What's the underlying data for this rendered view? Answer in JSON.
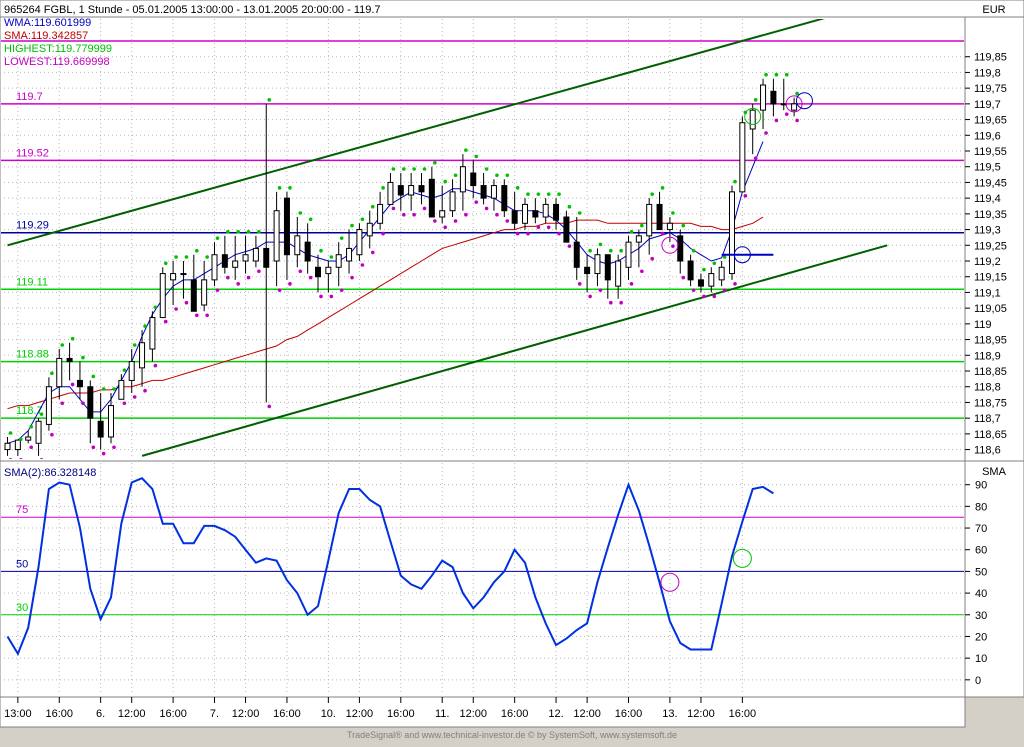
{
  "header": {
    "title": "965264  FGBL, 1 Stunde - 05.01.2005 13:00:00 - 13.01.2005 20:00:00 - 119.7",
    "legend": [
      {
        "text": "WMA:119.601999",
        "color": "#0000c0"
      },
      {
        "text": "SMA:119.342857",
        "color": "#c00000"
      },
      {
        "text": "HIGHEST:119.779999",
        "color": "#00c000"
      },
      {
        "text": "LOWEST:119.669998",
        "color": "#c000c0"
      }
    ],
    "currency": "EUR"
  },
  "lower_panel": {
    "legend": "SMA(2):86.328148",
    "indicator_label": "SMA"
  },
  "footer": {
    "credit": "TradeSignal® and www.technical-investor.de © by SystemSoft, www.systemsoft.de"
  },
  "colors": {
    "candle_up": "#ffffff",
    "candle_down": "#000000",
    "wma": "#0000c0",
    "sma": "#c00000",
    "highest": "#00c000",
    "lowest": "#c000c0",
    "channel": "#006000",
    "level_magenta": "#d000d0",
    "level_blue": "#0000a0",
    "level_green": "#00d000",
    "osc": "#0030e0"
  },
  "chart_data": [
    {
      "type": "candlestick",
      "title": "965264  FGBL, 1 Stunde",
      "ylim": [
        118.57,
        119.97
      ],
      "y_ticks": [
        118.6,
        118.65,
        118.7,
        118.75,
        118.8,
        118.85,
        118.9,
        118.95,
        119,
        119.05,
        119.1,
        119.15,
        119.2,
        119.25,
        119.3,
        119.35,
        119.4,
        119.45,
        119.5,
        119.55,
        119.6,
        119.65,
        119.7,
        119.75,
        119.8,
        119.85
      ],
      "x_tick_labels": [
        "13:00",
        "16:00",
        "6.",
        "12:00",
        "16:00",
        "7.",
        "12:00",
        "16:00",
        "10.",
        "12:00",
        "16:00",
        "11.",
        "12:00",
        "16:00",
        "12.",
        "12:00",
        "16:00",
        "13.",
        "12:00",
        "16:00"
      ],
      "x_tick_bars": [
        1,
        5,
        9,
        12,
        16,
        20,
        23,
        27,
        31,
        34,
        38,
        42,
        45,
        49,
        53,
        56,
        60,
        64,
        67,
        71
      ],
      "candles": [
        [
          118.64,
          118.58,
          118.6,
          118.62
        ],
        [
          118.62,
          118.58,
          118.6,
          118.63
        ],
        [
          118.66,
          118.62,
          118.63,
          118.64
        ],
        [
          118.7,
          118.58,
          118.62,
          118.69
        ],
        [
          118.83,
          118.66,
          118.68,
          118.8
        ],
        [
          118.92,
          118.76,
          118.8,
          118.89
        ],
        [
          118.94,
          118.82,
          118.89,
          118.88
        ],
        [
          118.88,
          118.76,
          118.82,
          118.8
        ],
        [
          118.82,
          118.62,
          118.8,
          118.7
        ],
        [
          118.78,
          118.6,
          118.69,
          118.64
        ],
        [
          118.78,
          118.62,
          118.64,
          118.74
        ],
        [
          118.84,
          118.76,
          118.76,
          118.82
        ],
        [
          118.92,
          118.78,
          118.82,
          118.88
        ],
        [
          118.98,
          118.8,
          118.86,
          118.94
        ],
        [
          119.04,
          118.88,
          118.92,
          119.02
        ],
        [
          119.18,
          119.02,
          119.02,
          119.16
        ],
        [
          119.2,
          119.06,
          119.14,
          119.16
        ],
        [
          119.2,
          119.08,
          119.16,
          119.16
        ],
        [
          119.22,
          119.04,
          119.14,
          119.04
        ],
        [
          119.2,
          119.04,
          119.06,
          119.14
        ],
        [
          119.26,
          119.12,
          119.14,
          119.22
        ],
        [
          119.28,
          119.16,
          119.22,
          119.18
        ],
        [
          119.28,
          119.14,
          119.18,
          119.2
        ],
        [
          119.28,
          119.16,
          119.2,
          119.22
        ],
        [
          119.28,
          119.18,
          119.2,
          119.24
        ],
        [
          119.7,
          118.75,
          119.24,
          119.18
        ],
        [
          119.42,
          119.12,
          119.2,
          119.36
        ],
        [
          119.42,
          119.14,
          119.4,
          119.22
        ],
        [
          119.34,
          119.18,
          119.22,
          119.28
        ],
        [
          119.32,
          119.16,
          119.26,
          119.2
        ],
        [
          119.22,
          119.1,
          119.18,
          119.15
        ],
        [
          119.2,
          119.1,
          119.16,
          119.18
        ],
        [
          119.26,
          119.12,
          119.18,
          119.22
        ],
        [
          119.3,
          119.16,
          119.2,
          119.24
        ],
        [
          119.32,
          119.2,
          119.22,
          119.3
        ],
        [
          119.36,
          119.24,
          119.28,
          119.32
        ],
        [
          119.42,
          119.3,
          119.32,
          119.38
        ],
        [
          119.48,
          119.38,
          119.38,
          119.45
        ],
        [
          119.48,
          119.36,
          119.44,
          119.41
        ],
        [
          119.48,
          119.36,
          119.41,
          119.44
        ],
        [
          119.48,
          119.38,
          119.44,
          119.42
        ],
        [
          119.5,
          119.34,
          119.46,
          119.34
        ],
        [
          119.44,
          119.32,
          119.34,
          119.36
        ],
        [
          119.46,
          119.34,
          119.36,
          119.42
        ],
        [
          119.54,
          119.36,
          119.42,
          119.5
        ],
        [
          119.52,
          119.4,
          119.48,
          119.44
        ],
        [
          119.48,
          119.38,
          119.44,
          119.4
        ],
        [
          119.46,
          119.36,
          119.4,
          119.44
        ],
        [
          119.46,
          119.34,
          119.44,
          119.36
        ],
        [
          119.42,
          119.3,
          119.36,
          119.32
        ],
        [
          119.4,
          119.3,
          119.32,
          119.38
        ],
        [
          119.4,
          119.32,
          119.36,
          119.34
        ],
        [
          119.4,
          119.32,
          119.34,
          119.38
        ],
        [
          119.4,
          119.3,
          119.38,
          119.33
        ],
        [
          119.36,
          119.26,
          119.34,
          119.26
        ],
        [
          119.34,
          119.14,
          119.26,
          119.18
        ],
        [
          119.22,
          119.1,
          119.18,
          119.16
        ],
        [
          119.24,
          119.12,
          119.16,
          119.22
        ],
        [
          119.22,
          119.08,
          119.22,
          119.14
        ],
        [
          119.22,
          119.08,
          119.12,
          119.2
        ],
        [
          119.28,
          119.14,
          119.18,
          119.26
        ],
        [
          119.3,
          119.18,
          119.26,
          119.28
        ],
        [
          119.4,
          119.22,
          119.28,
          119.38
        ],
        [
          119.42,
          119.3,
          119.38,
          119.3
        ],
        [
          119.34,
          119.26,
          119.3,
          119.32
        ],
        [
          119.3,
          119.16,
          119.28,
          119.2
        ],
        [
          119.22,
          119.12,
          119.2,
          119.14
        ],
        [
          119.16,
          119.1,
          119.14,
          119.12
        ],
        [
          119.18,
          119.1,
          119.12,
          119.16
        ],
        [
          119.2,
          119.12,
          119.14,
          119.18
        ],
        [
          119.44,
          119.14,
          119.16,
          119.42
        ],
        [
          119.66,
          119.42,
          119.42,
          119.64
        ],
        [
          119.7,
          119.54,
          119.62,
          119.68
        ],
        [
          119.78,
          119.62,
          119.68,
          119.76
        ],
        [
          119.78,
          119.66,
          119.74,
          119.7
        ],
        [
          119.78,
          119.68,
          119.7,
          119.7
        ],
        [
          119.72,
          119.66,
          119.68,
          119.7
        ]
      ],
      "wma": [
        118.62,
        118.63,
        118.66,
        118.72,
        118.78,
        118.8,
        118.8,
        118.76,
        118.72,
        118.72,
        118.76,
        118.82,
        118.88,
        118.96,
        119.03,
        119.08,
        119.12,
        119.14,
        119.14,
        119.16,
        119.18,
        119.2,
        119.22,
        119.23,
        119.24,
        119.26,
        119.26,
        119.26,
        119.24,
        119.22,
        119.21,
        119.2,
        119.2,
        119.22,
        119.26,
        119.3,
        119.34,
        119.38,
        119.4,
        119.42,
        119.41,
        119.4,
        119.41,
        119.43,
        119.43,
        119.42,
        119.41,
        119.4,
        119.38,
        119.36,
        119.36,
        119.36,
        119.35,
        119.33,
        119.3,
        119.26,
        119.22,
        119.2,
        119.19,
        119.2,
        119.22,
        119.24,
        119.27,
        119.28,
        119.29,
        119.27,
        119.24,
        119.22,
        119.2,
        119.21,
        119.3,
        119.42,
        119.5,
        119.58
      ],
      "sma": [
        118.73,
        118.74,
        118.74,
        118.75,
        118.76,
        118.77,
        118.78,
        118.78,
        118.78,
        118.79,
        118.79,
        118.8,
        118.8,
        118.81,
        118.82,
        118.82,
        118.83,
        118.84,
        118.85,
        118.86,
        118.87,
        118.88,
        118.89,
        118.9,
        118.91,
        118.92,
        118.93,
        118.95,
        118.96,
        118.98,
        119.0,
        119.02,
        119.04,
        119.06,
        119.08,
        119.1,
        119.12,
        119.14,
        119.16,
        119.18,
        119.2,
        119.22,
        119.24,
        119.25,
        119.26,
        119.27,
        119.28,
        119.29,
        119.3,
        119.3,
        119.31,
        119.31,
        119.32,
        119.32,
        119.32,
        119.33,
        119.33,
        119.33,
        119.32,
        119.32,
        119.32,
        119.32,
        119.32,
        119.32,
        119.32,
        119.32,
        119.32,
        119.31,
        119.31,
        119.3,
        119.3,
        119.31,
        119.32,
        119.34
      ],
      "levels": [
        {
          "value": 119.9,
          "label": "",
          "color": "#d000d0"
        },
        {
          "value": 119.7,
          "label": "119.7",
          "color": "#d000d0"
        },
        {
          "value": 119.52,
          "label": "119.52",
          "color": "#d000d0"
        },
        {
          "value": 119.29,
          "label": "119.29",
          "color": "#0000a0"
        },
        {
          "value": 119.11,
          "label": "119.11",
          "color": "#00d000"
        },
        {
          "value": 118.88,
          "label": "118.88",
          "color": "#00d000"
        },
        {
          "value": 118.7,
          "label": "118.7",
          "color": "#00d000"
        }
      ],
      "channel": [
        {
          "from": [
            0,
            119.25
          ],
          "to": [
            83,
            120.01
          ]
        },
        {
          "from": [
            13,
            118.58
          ],
          "to": [
            85,
            119.25
          ]
        }
      ]
    },
    {
      "type": "line",
      "title": "SMA(2):86.328148",
      "ylim": [
        -7,
        100
      ],
      "y_ticks": [
        0,
        10,
        20,
        30,
        40,
        50,
        60,
        70,
        80,
        90
      ],
      "levels": [
        {
          "value": 75,
          "label": "75",
          "color": "#d000d0"
        },
        {
          "value": 50,
          "label": "50",
          "color": "#0000a0"
        },
        {
          "value": 30,
          "label": "30",
          "color": "#00d000"
        }
      ],
      "series": [
        {
          "values": [
            20,
            12,
            24,
            52,
            88,
            91,
            90,
            70,
            42,
            28,
            38,
            72,
            91,
            93,
            88,
            72,
            72,
            63,
            63,
            71,
            71,
            69,
            66,
            60,
            54,
            56,
            55,
            46,
            40,
            30,
            34,
            55,
            77,
            88,
            88,
            83,
            80,
            64,
            48,
            44,
            42,
            48,
            55,
            52,
            40,
            33,
            38,
            45,
            50,
            60,
            54,
            38,
            26,
            16,
            19,
            23,
            26,
            45,
            61,
            76,
            90,
            78,
            62,
            45,
            27,
            17,
            14,
            14,
            14,
            35,
            57,
            73,
            88,
            89,
            86
          ]
        }
      ],
      "markers": [
        {
          "x": 64,
          "y": 45,
          "color": "#c000c0"
        },
        {
          "x": 71,
          "y": 56,
          "color": "#00c000"
        }
      ]
    }
  ]
}
